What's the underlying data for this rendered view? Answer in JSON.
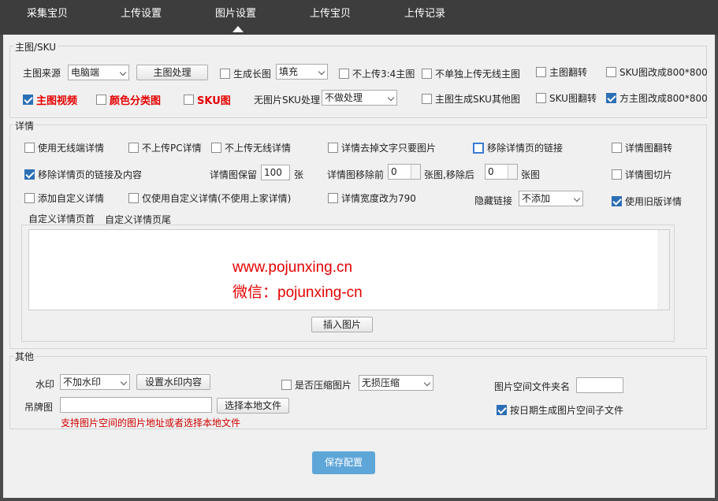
{
  "nav": {
    "tabs": [
      "采集宝贝",
      "上传设置",
      "图片设置",
      "上传宝贝",
      "上传记录"
    ],
    "active": "图片设置"
  },
  "main_image": {
    "legend": "主图/SKU",
    "source_label": "主图来源",
    "source_value": "电脑端",
    "process_button": "主图处理",
    "gen_long_label": "生成长图",
    "fill_value": "填充",
    "no_upload_34": "不上传3:4主图",
    "no_separate_wireless": "不单独上传无线主图",
    "flip_main": "主图翻转",
    "sku_800": "SKU图改成800*800",
    "main_video": "主图视频",
    "color_category": "颜色分类图",
    "sku_image": "SKU图",
    "no_sku_label": "无图片SKU处理",
    "no_sku_value": "不做处理",
    "gen_sku_other": "主图生成SKU其他图",
    "sku_flip": "SKU图翻转",
    "square_800": "方主图改成800*800"
  },
  "details": {
    "legend": "详情",
    "use_wireless": "使用无线端详情",
    "no_pc": "不上传PC详情",
    "no_wireless": "不上传无线详情",
    "text_to_image": "详情去掉文字只要图片",
    "remove_links": "移除详情页的链接",
    "detail_flip": "详情图翻转",
    "remove_links_content": "移除详情页的链接及内容",
    "keep_label": "详情图保留",
    "keep_value": "100",
    "keep_unit": "张",
    "remove_front_label": "详情图移除前",
    "remove_front_value": "0",
    "remove_back_label": "张图,移除后",
    "remove_back_value": "0",
    "remove_back_unit": "张图",
    "detail_slice": "详情图切片",
    "add_custom": "添加自定义详情",
    "only_custom": "仅使用自定义详情(不使用上家详情)",
    "width_790": "详情宽度改为790",
    "hide_links_label": "隐藏链接",
    "hide_links_value": "不添加",
    "use_old": "使用旧版详情",
    "tab_header": "自定义详情页首",
    "tab_footer": "自定义详情页尾",
    "insert_image": "插入图片",
    "watermark_line1": "www.pojunxing.cn",
    "watermark_line2": "微信：pojunxing-cn"
  },
  "other": {
    "legend": "其他",
    "watermark_label": "水印",
    "watermark_value": "不加水印",
    "set_watermark": "设置水印内容",
    "compress_label": "是否压缩图片",
    "compress_value": "无损压缩",
    "folder_label": "图片空间文件夹名",
    "folder_value": "",
    "hangtag_label": "吊牌图",
    "hangtag_value": "",
    "choose_local": "选择本地文件",
    "hint": "支持图片空间的图片地址或者选择本地文件",
    "date_subfolder": "按日期生成图片空间子文件"
  },
  "save_button": "保存配置",
  "colors": {
    "accent": "#5fa6d8",
    "checkbox": "#2b6fb6",
    "red": "#e60000",
    "nav": "#3d3d3d"
  }
}
